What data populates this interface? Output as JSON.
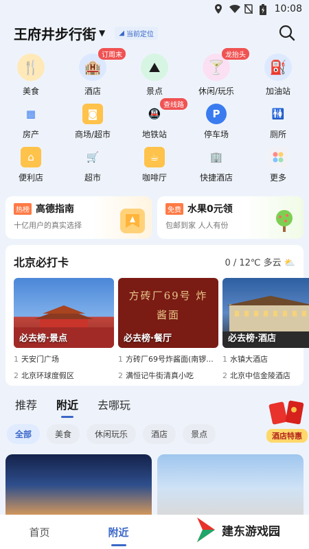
{
  "status": {
    "time": "10:08"
  },
  "header": {
    "location": "王府井步行街",
    "current_location": "当前定位"
  },
  "categories": [
    [
      {
        "label": "美食",
        "icon": "fork-knife-icon",
        "badge": ""
      },
      {
        "label": "酒店",
        "icon": "hotel-icon",
        "badge": "订周末"
      },
      {
        "label": "景点",
        "icon": "scenic-icon",
        "badge": ""
      },
      {
        "label": "休闲/玩乐",
        "icon": "cocktail-icon",
        "badge": "龙抬头"
      },
      {
        "label": "加油站",
        "icon": "gas-station-icon",
        "badge": ""
      }
    ],
    [
      {
        "label": "房产",
        "icon": "building-icon",
        "badge": ""
      },
      {
        "label": "商场/超市",
        "icon": "shopping-bag-icon",
        "badge": ""
      },
      {
        "label": "地铁站",
        "icon": "subway-icon",
        "badge": "查线路"
      },
      {
        "label": "停车场",
        "icon": "parking-icon",
        "badge": ""
      },
      {
        "label": "厕所",
        "icon": "restroom-icon",
        "badge": ""
      }
    ],
    [
      {
        "label": "便利店",
        "icon": "store-icon",
        "badge": ""
      },
      {
        "label": "超市",
        "icon": "cart-icon",
        "badge": ""
      },
      {
        "label": "咖啡厅",
        "icon": "coffee-icon",
        "badge": ""
      },
      {
        "label": "快捷酒店",
        "icon": "quick-hotel-icon",
        "badge": ""
      },
      {
        "label": "更多",
        "icon": "more-icon",
        "badge": ""
      }
    ]
  ],
  "promos": [
    {
      "tag": "热榜",
      "title": "高德指南",
      "sub": "十亿用户的真实选择"
    },
    {
      "tag": "免费",
      "title": "水果0元领",
      "sub": "包邮到家 人人有份"
    }
  ],
  "checkin": {
    "title": "北京必打卡",
    "weather": "0 / 12℃ 多云",
    "cards": [
      {
        "caption": "必去榜·景点",
        "items": [
          "天安门广场",
          "北京环球度假区"
        ]
      },
      {
        "caption": "必去榜·餐厅",
        "items": [
          "方砖厂69号炸酱面(南锣...",
          "满恒记牛街清真小吃"
        ]
      },
      {
        "caption": "必去榜·酒店",
        "items": [
          "水镇大酒店",
          "北京中信金陵酒店"
        ]
      }
    ],
    "sign_text": "方砖厂69号 炸酱面"
  },
  "tabs": [
    "推荐",
    "附近",
    "去哪玩"
  ],
  "hotel_promo": "酒店特惠",
  "chips": [
    "全部",
    "美食",
    "休闲玩乐",
    "酒店",
    "景点"
  ],
  "bottomnav": [
    "首页",
    "附近"
  ],
  "watermark": "建东游戏园",
  "accent": "#3a67c8"
}
